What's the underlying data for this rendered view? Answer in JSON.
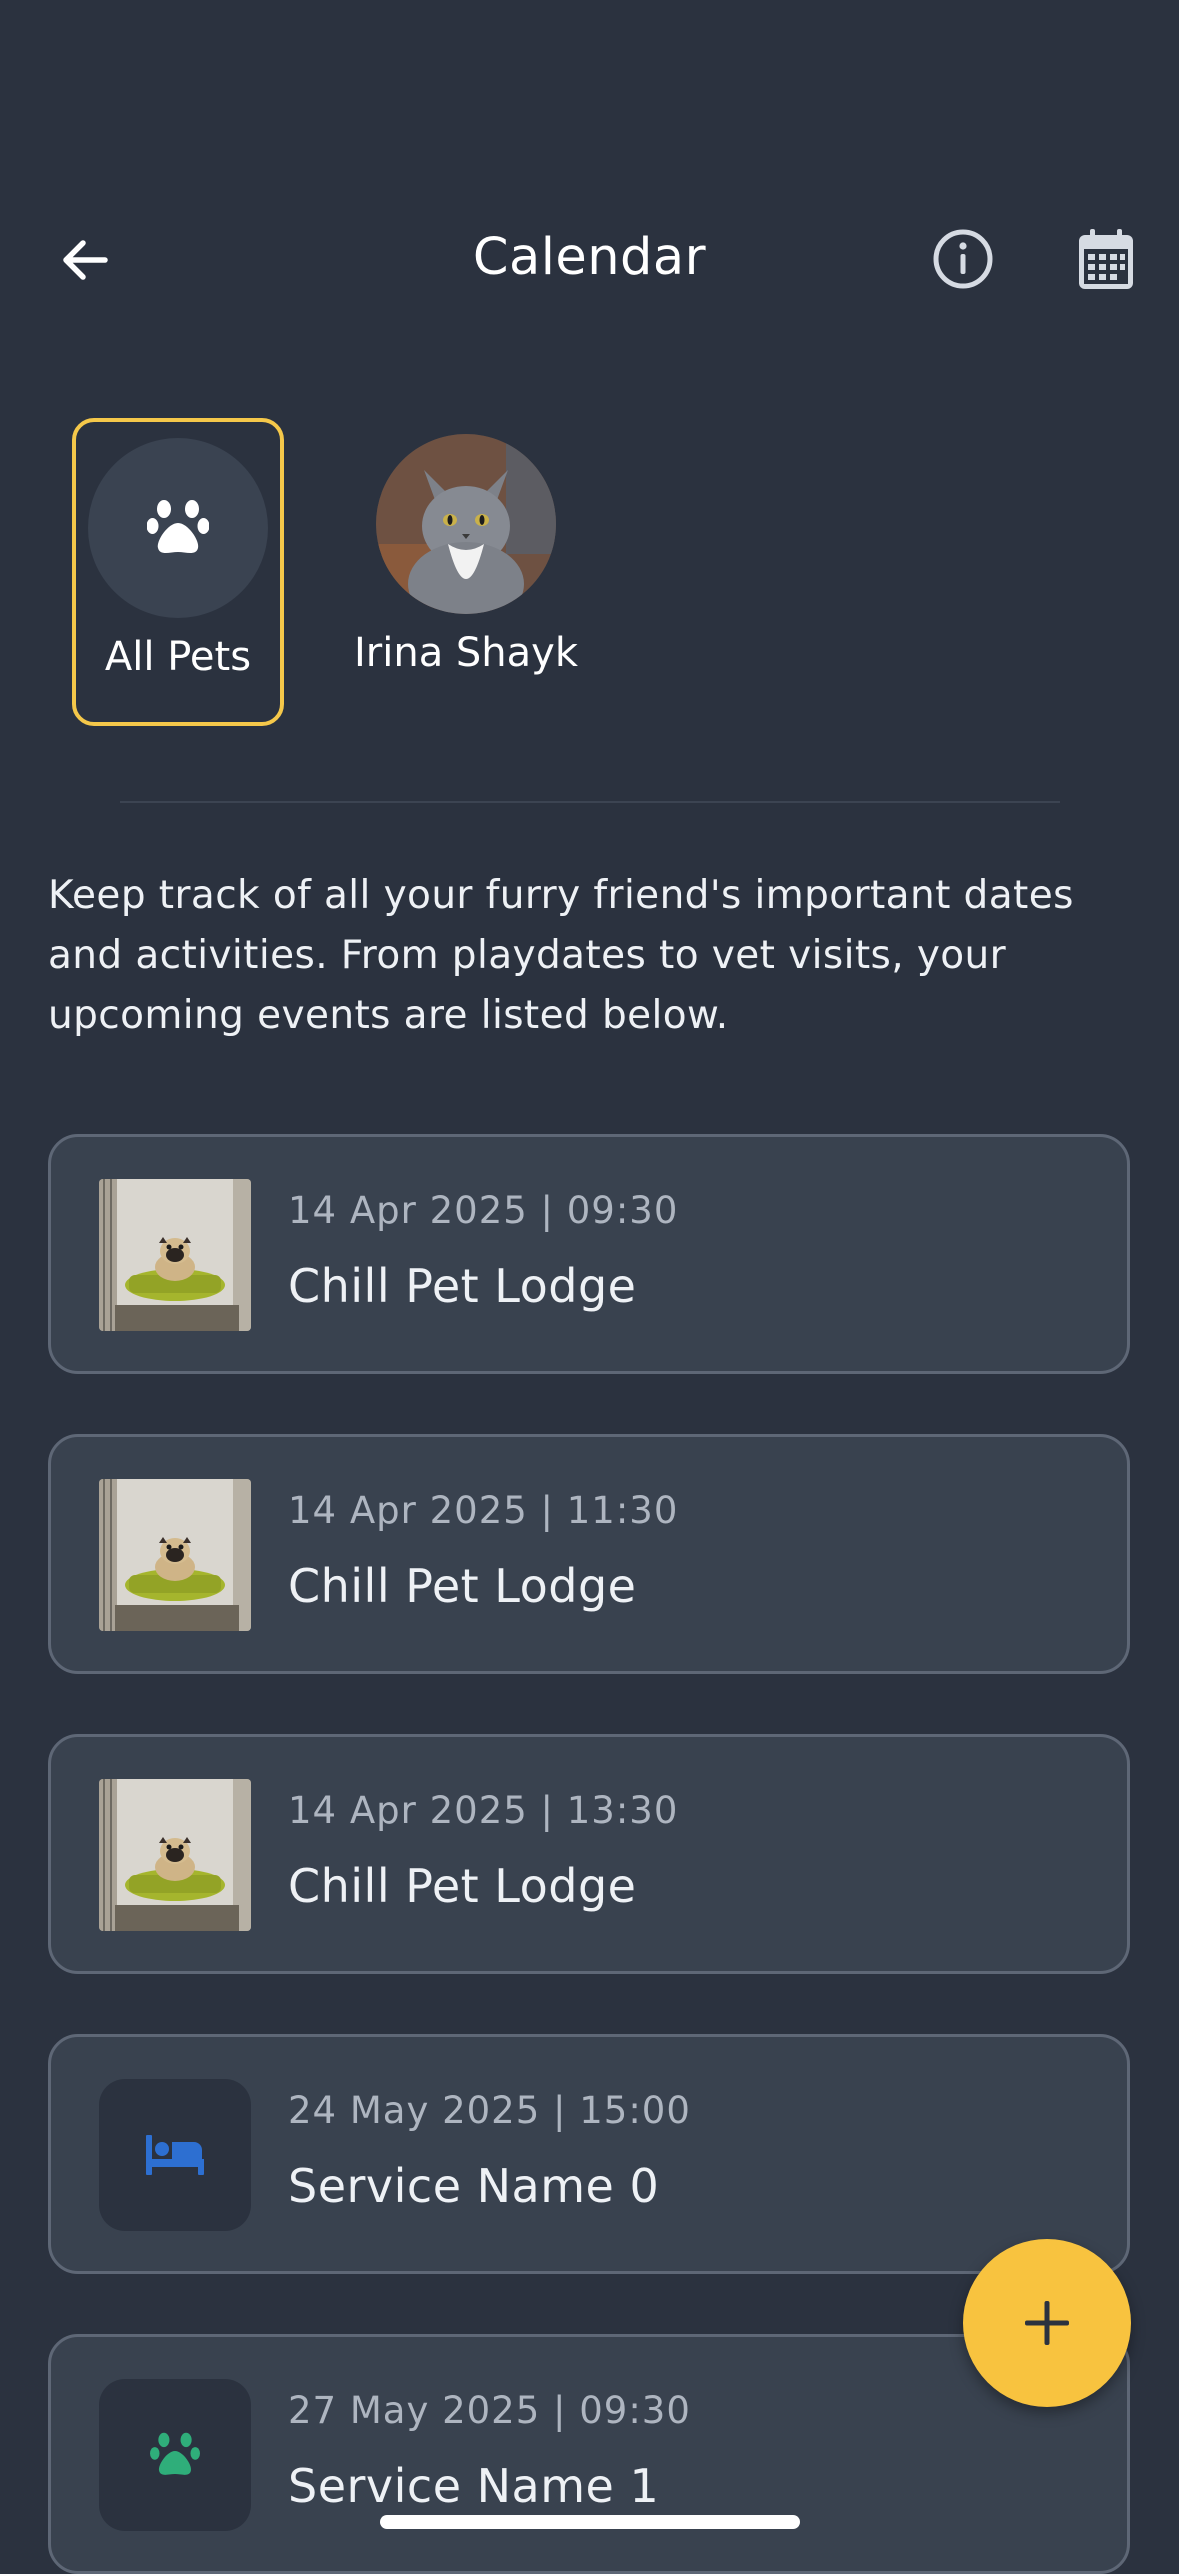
{
  "header": {
    "title": "Calendar"
  },
  "pets": [
    {
      "label": "All Pets",
      "selected": true
    },
    {
      "label": "Irina Shayk",
      "selected": false
    }
  ],
  "intro": "Keep track of all your furry friend's important dates and activities. From playdates to vet visits, your upcoming events are listed below.",
  "events": [
    {
      "date": "14 Apr 2025 | 09:30",
      "name": "Chill Pet Lodge",
      "thumb": "pug-in-kennel-photo"
    },
    {
      "date": "14 Apr 2025 | 11:30",
      "name": "Chill Pet Lodge",
      "thumb": "pug-in-kennel-photo"
    },
    {
      "date": "14 Apr 2025 | 13:30",
      "name": "Chill Pet Lodge",
      "thumb": "pug-in-kennel-photo"
    },
    {
      "date": "24 May 2025 | 15:00",
      "name": "Service Name 0",
      "icon": "bed-icon",
      "icon_color": "#2d6fd1"
    },
    {
      "date": "27 May 2025 | 09:30",
      "name": "Service Name 1",
      "icon": "paw-icon",
      "icon_color": "#2fae7a"
    }
  ],
  "colors": {
    "background": "#2b323f",
    "card": "#39424f",
    "accent": "#f8c33f"
  }
}
